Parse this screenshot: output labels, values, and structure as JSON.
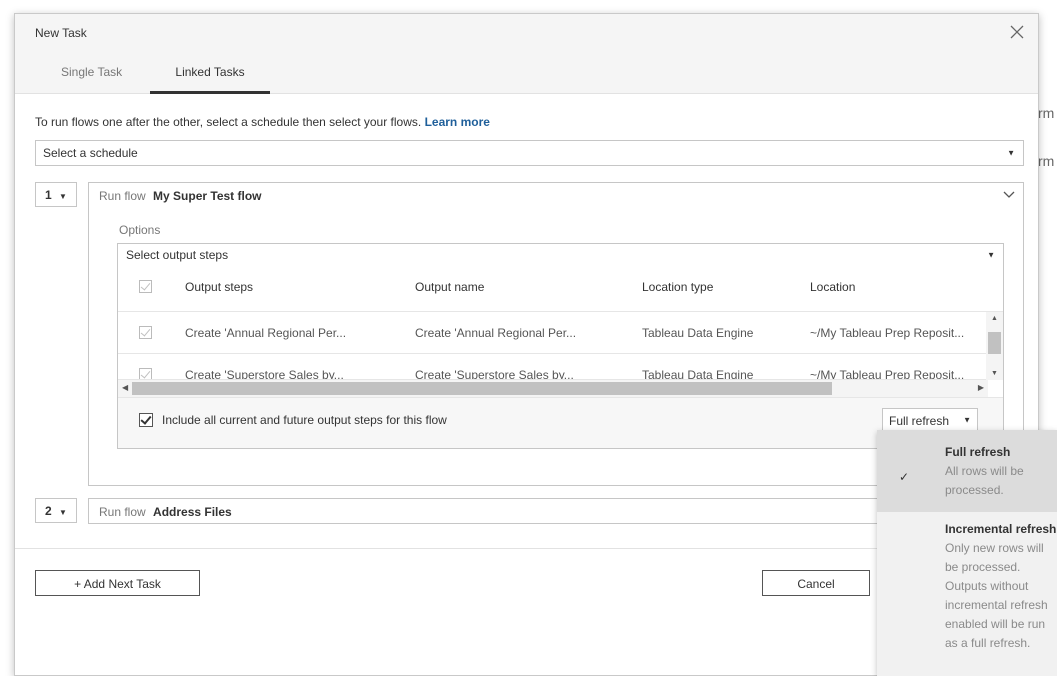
{
  "background": {
    "frag1": "rm",
    "frag2": "rm"
  },
  "dialog": {
    "title": "New Task",
    "close_icon": "close-icon",
    "tabs": [
      {
        "label": "Single Task",
        "active": false
      },
      {
        "label": "Linked Tasks",
        "active": true
      }
    ],
    "description": "To run flows one after the other, select a schedule then select your flows.",
    "learn_more": "Learn more",
    "schedule_placeholder": "Select a schedule",
    "steps": [
      {
        "number": "1",
        "run_flow_label": "Run flow",
        "flow_name": "My Super Test flow",
        "options_label": "Options",
        "output_select_placeholder": "Select output steps",
        "columns": [
          "Output steps",
          "Output name",
          "Location type",
          "Location"
        ],
        "rows": [
          {
            "output_step": "Create 'Annual Regional Per...",
            "output_name": "Create 'Annual Regional Per...",
            "location_type": "Tableau Data Engine",
            "location": "~/My Tableau Prep Reposit..."
          },
          {
            "output_step": "Create 'Superstore Sales by...",
            "output_name": "Create 'Superstore Sales by...",
            "location_type": "Tableau Data Engine",
            "location": "~/My Tableau Prep Reposit..."
          }
        ],
        "include_label": "Include all current and future output steps for this flow",
        "refresh_value": "Full refresh"
      },
      {
        "number": "2",
        "run_flow_label": "Run flow",
        "flow_name": "Address Files"
      }
    ],
    "add_button": "+ Add Next Task",
    "cancel_button": "Cancel"
  },
  "refresh_menu": {
    "items": [
      {
        "title": "Full refresh",
        "description": "All rows will be processed.",
        "selected": true
      },
      {
        "title": "Incremental refresh",
        "description": "Only new rows will be processed. Outputs without incremental refresh enabled will be run as a full refresh.",
        "selected": false
      }
    ],
    "check_glyph": "✓"
  }
}
